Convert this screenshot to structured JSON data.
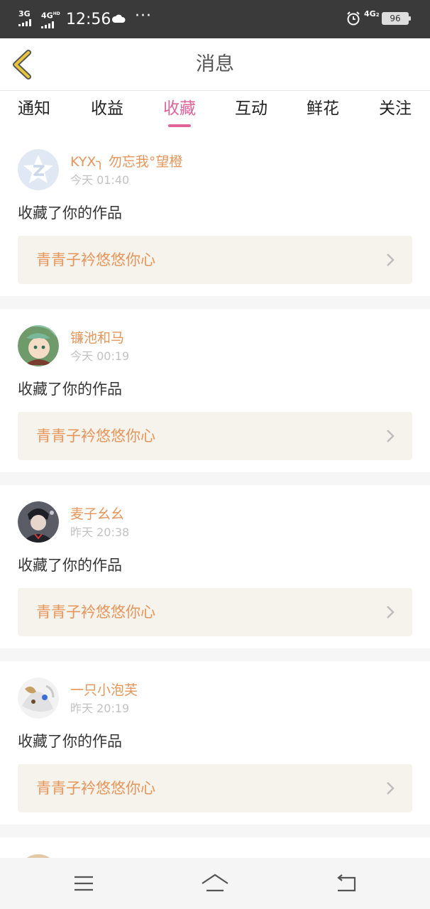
{
  "status_bar": {
    "net1": "3G",
    "net2": "4G",
    "net2_sup": "HD",
    "time": "12:56",
    "dots": "···",
    "net3": "4G",
    "net3_sub": "2",
    "battery": "96",
    "icons": [
      "signal-icon",
      "cloud-icon",
      "alarm-icon",
      "battery-icon"
    ]
  },
  "header": {
    "title": "消息",
    "back_icon": "back-chevron-icon",
    "accent_color": "#e8c53a"
  },
  "tabs": [
    {
      "label": "通知",
      "active": false
    },
    {
      "label": "收益",
      "active": false
    },
    {
      "label": "收藏",
      "active": true
    },
    {
      "label": "互动",
      "active": false
    },
    {
      "label": "鲜花",
      "active": false
    },
    {
      "label": "关注",
      "active": false
    }
  ],
  "colors": {
    "active_tab": "#e0639a",
    "username": "#e8955a",
    "work_title": "#e8955a",
    "work_bg": "#f5f3ec"
  },
  "feed": [
    {
      "user": "KYX╮ 勿忘我°望橙",
      "time": "今天 01:40",
      "action": "收藏了你的作品",
      "work": "青青子衿悠悠你心",
      "avatar": "default-avatar-icon"
    },
    {
      "user": "镰池和马",
      "time": "今天 00:19",
      "action": "收藏了你的作品",
      "work": "青青子衿悠悠你心",
      "avatar": "user-avatar"
    },
    {
      "user": "麦子幺幺",
      "time": "昨天 20:38",
      "action": "收藏了你的作品",
      "work": "青青子衿悠悠你心",
      "avatar": "user-avatar"
    },
    {
      "user": "一只小泡芙",
      "time": "昨天 20:19",
      "action": "收藏了你的作品",
      "work": "青青子衿悠悠你心",
      "avatar": "user-avatar"
    }
  ],
  "navbar": {
    "icons": [
      "menu-icon",
      "home-icon",
      "back-icon"
    ]
  }
}
